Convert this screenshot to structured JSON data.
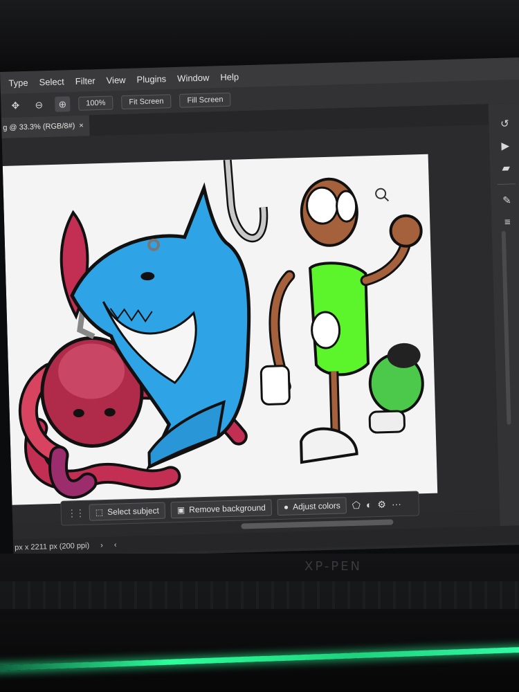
{
  "menu": [
    "Type",
    "Select",
    "Filter",
    "View",
    "Plugins",
    "Window",
    "Help"
  ],
  "options": {
    "zoom_value": "100%",
    "fit_screen": "Fit Screen",
    "fill_screen": "Fill Screen"
  },
  "doc_tab": {
    "title": "g @ 33.3% (RGB/8#)",
    "close": "×"
  },
  "collapse": "«",
  "contextual_taskbar": {
    "select_subject": "Select subject",
    "remove_background": "Remove background",
    "adjust_colors": "Adjust colors",
    "more": "···"
  },
  "status": {
    "doc_info": "px x 2211 px (200 ppi)",
    "next": "›",
    "prev": "‹"
  },
  "brand": "XP-PEN",
  "icons": {
    "move": "move-icon",
    "zoom_in": "zoom-in-icon",
    "zoom_out": "zoom-out-icon"
  },
  "colors": {
    "canvas": "#f4f4f4",
    "shark": "#2ea3e6",
    "octopus": "#c22f52",
    "ant": "#a5603c",
    "shirt": "#5cf52b",
    "hulk": "#4cc94a",
    "led": "#2dff9a"
  }
}
